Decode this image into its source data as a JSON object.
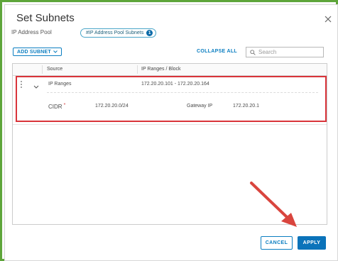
{
  "dialog": {
    "title": "Set Subnets"
  },
  "pool": {
    "label": "IP Address Pool",
    "chip_text": "#IP Address Pool Subnets",
    "chip_count": "1"
  },
  "toolbar": {
    "add_subnet_label": "ADD SUBNET",
    "collapse_all_label": "COLLAPSE ALL",
    "search_placeholder": "Search"
  },
  "grid": {
    "columns": [
      "Source",
      "IP Ranges / Block"
    ],
    "rows": [
      {
        "source": "IP Ranges",
        "ip_range": "172.20.20.101 - 172.20.20.164",
        "details": {
          "cidr_label": "CIDR",
          "required_mark": "*",
          "cidr_value": "172.20.20.0/24",
          "gateway_label": "Gateway IP",
          "gateway_value": "172.20.20.1"
        }
      }
    ]
  },
  "footer": {
    "cancel_label": "CANCEL",
    "apply_label": "APPLY"
  },
  "colors": {
    "accent": "#0b7ec1",
    "primary_button": "#0b73ba",
    "highlight_box": "#d9343a",
    "annotation_arrow": "#d9453e",
    "frame_border": "#5ea53a"
  },
  "icons": [
    "close-icon",
    "chevron-down-icon",
    "search-icon",
    "kebab-menu-icon",
    "expand-chevron-icon"
  ]
}
